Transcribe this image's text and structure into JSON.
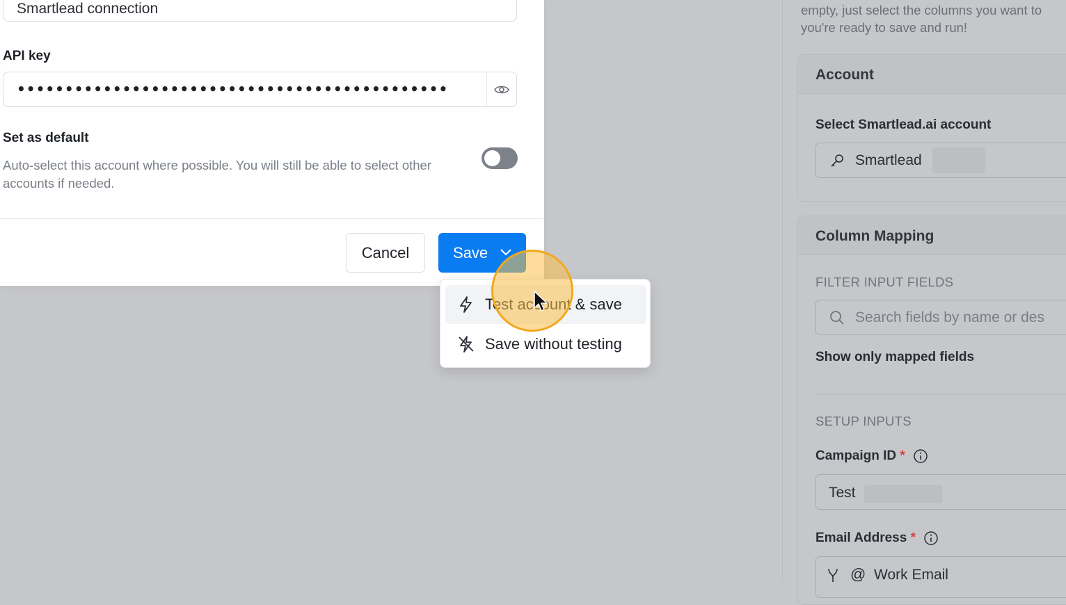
{
  "modal": {
    "connection_name_value": "Smartlead connection",
    "api_key_label": "API key",
    "api_key_masked": "•••••••••••••••••••••••••••••••••••••••••••••",
    "set_default_label": "Set as default",
    "set_default_description": "Auto-select this account where possible. You will still be able to select other accounts if needed.",
    "set_default_on": false,
    "cancel_label": "Cancel",
    "save_label": "Save"
  },
  "save_menu": {
    "items": [
      {
        "label": "Test account & save",
        "icon": "lightning-icon",
        "active": true
      },
      {
        "label": "Save without testing",
        "icon": "lightning-off-icon",
        "active": false
      }
    ]
  },
  "right_panel": {
    "intro_line1": "empty, just select the columns you want to",
    "intro_line2": "you're ready to save and run!",
    "account_card": {
      "title": "Account",
      "select_label": "Select Smartlead.ai account",
      "selected_value": "Smartlead"
    },
    "mapping_card": {
      "title": "Column Mapping",
      "filter_section": "FILTER INPUT FIELDS",
      "search_placeholder": "Search fields by name or des",
      "show_mapped_label": "Show only mapped fields",
      "setup_section": "SETUP INPUTS",
      "campaign_label": "Campaign ID",
      "campaign_value": "Test",
      "email_label": "Email Address",
      "email_value": "Work Email",
      "required_mark": "*"
    }
  },
  "colors": {
    "primary": "#0a7cf1",
    "overlay": "#c6c7ca",
    "cursor_highlight": "#f2a81d"
  }
}
